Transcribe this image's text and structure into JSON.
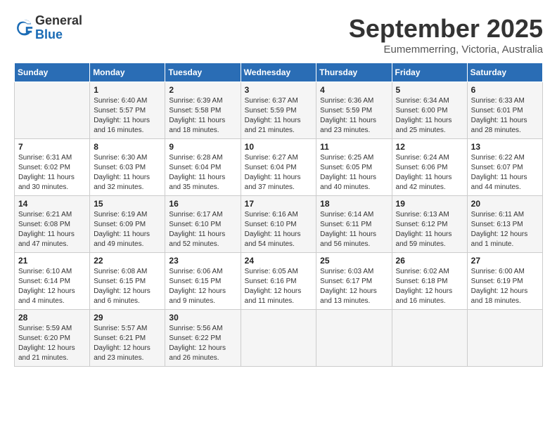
{
  "header": {
    "logo": {
      "general": "General",
      "blue": "Blue"
    },
    "title": "September 2025",
    "location": "Eumemmerring, Victoria, Australia"
  },
  "weekdays": [
    "Sunday",
    "Monday",
    "Tuesday",
    "Wednesday",
    "Thursday",
    "Friday",
    "Saturday"
  ],
  "weeks": [
    [
      {
        "day": "",
        "info": ""
      },
      {
        "day": "1",
        "info": "Sunrise: 6:40 AM\nSunset: 5:57 PM\nDaylight: 11 hours\nand 16 minutes."
      },
      {
        "day": "2",
        "info": "Sunrise: 6:39 AM\nSunset: 5:58 PM\nDaylight: 11 hours\nand 18 minutes."
      },
      {
        "day": "3",
        "info": "Sunrise: 6:37 AM\nSunset: 5:59 PM\nDaylight: 11 hours\nand 21 minutes."
      },
      {
        "day": "4",
        "info": "Sunrise: 6:36 AM\nSunset: 5:59 PM\nDaylight: 11 hours\nand 23 minutes."
      },
      {
        "day": "5",
        "info": "Sunrise: 6:34 AM\nSunset: 6:00 PM\nDaylight: 11 hours\nand 25 minutes."
      },
      {
        "day": "6",
        "info": "Sunrise: 6:33 AM\nSunset: 6:01 PM\nDaylight: 11 hours\nand 28 minutes."
      }
    ],
    [
      {
        "day": "7",
        "info": "Sunrise: 6:31 AM\nSunset: 6:02 PM\nDaylight: 11 hours\nand 30 minutes."
      },
      {
        "day": "8",
        "info": "Sunrise: 6:30 AM\nSunset: 6:03 PM\nDaylight: 11 hours\nand 32 minutes."
      },
      {
        "day": "9",
        "info": "Sunrise: 6:28 AM\nSunset: 6:04 PM\nDaylight: 11 hours\nand 35 minutes."
      },
      {
        "day": "10",
        "info": "Sunrise: 6:27 AM\nSunset: 6:04 PM\nDaylight: 11 hours\nand 37 minutes."
      },
      {
        "day": "11",
        "info": "Sunrise: 6:25 AM\nSunset: 6:05 PM\nDaylight: 11 hours\nand 40 minutes."
      },
      {
        "day": "12",
        "info": "Sunrise: 6:24 AM\nSunset: 6:06 PM\nDaylight: 11 hours\nand 42 minutes."
      },
      {
        "day": "13",
        "info": "Sunrise: 6:22 AM\nSunset: 6:07 PM\nDaylight: 11 hours\nand 44 minutes."
      }
    ],
    [
      {
        "day": "14",
        "info": "Sunrise: 6:21 AM\nSunset: 6:08 PM\nDaylight: 11 hours\nand 47 minutes."
      },
      {
        "day": "15",
        "info": "Sunrise: 6:19 AM\nSunset: 6:09 PM\nDaylight: 11 hours\nand 49 minutes."
      },
      {
        "day": "16",
        "info": "Sunrise: 6:17 AM\nSunset: 6:10 PM\nDaylight: 11 hours\nand 52 minutes."
      },
      {
        "day": "17",
        "info": "Sunrise: 6:16 AM\nSunset: 6:10 PM\nDaylight: 11 hours\nand 54 minutes."
      },
      {
        "day": "18",
        "info": "Sunrise: 6:14 AM\nSunset: 6:11 PM\nDaylight: 11 hours\nand 56 minutes."
      },
      {
        "day": "19",
        "info": "Sunrise: 6:13 AM\nSunset: 6:12 PM\nDaylight: 11 hours\nand 59 minutes."
      },
      {
        "day": "20",
        "info": "Sunrise: 6:11 AM\nSunset: 6:13 PM\nDaylight: 12 hours\nand 1 minute."
      }
    ],
    [
      {
        "day": "21",
        "info": "Sunrise: 6:10 AM\nSunset: 6:14 PM\nDaylight: 12 hours\nand 4 minutes."
      },
      {
        "day": "22",
        "info": "Sunrise: 6:08 AM\nSunset: 6:15 PM\nDaylight: 12 hours\nand 6 minutes."
      },
      {
        "day": "23",
        "info": "Sunrise: 6:06 AM\nSunset: 6:15 PM\nDaylight: 12 hours\nand 9 minutes."
      },
      {
        "day": "24",
        "info": "Sunrise: 6:05 AM\nSunset: 6:16 PM\nDaylight: 12 hours\nand 11 minutes."
      },
      {
        "day": "25",
        "info": "Sunrise: 6:03 AM\nSunset: 6:17 PM\nDaylight: 12 hours\nand 13 minutes."
      },
      {
        "day": "26",
        "info": "Sunrise: 6:02 AM\nSunset: 6:18 PM\nDaylight: 12 hours\nand 16 minutes."
      },
      {
        "day": "27",
        "info": "Sunrise: 6:00 AM\nSunset: 6:19 PM\nDaylight: 12 hours\nand 18 minutes."
      }
    ],
    [
      {
        "day": "28",
        "info": "Sunrise: 5:59 AM\nSunset: 6:20 PM\nDaylight: 12 hours\nand 21 minutes."
      },
      {
        "day": "29",
        "info": "Sunrise: 5:57 AM\nSunset: 6:21 PM\nDaylight: 12 hours\nand 23 minutes."
      },
      {
        "day": "30",
        "info": "Sunrise: 5:56 AM\nSunset: 6:22 PM\nDaylight: 12 hours\nand 26 minutes."
      },
      {
        "day": "",
        "info": ""
      },
      {
        "day": "",
        "info": ""
      },
      {
        "day": "",
        "info": ""
      },
      {
        "day": "",
        "info": ""
      }
    ]
  ]
}
